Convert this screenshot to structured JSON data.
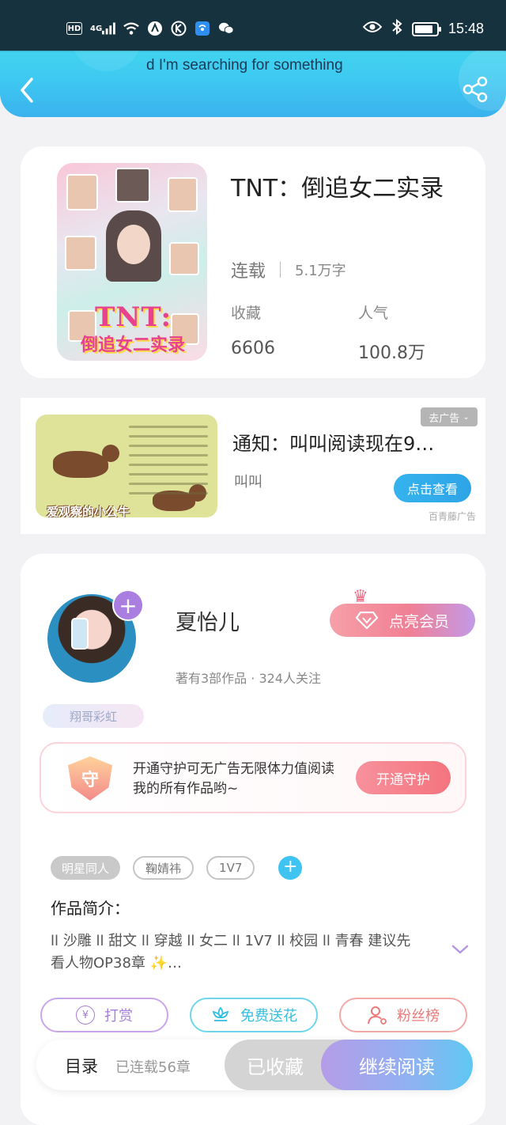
{
  "status_bar": {
    "time": "15:48",
    "network": "4G",
    "hd": "HD"
  },
  "header": {
    "marquee_text": "d I'm searching for something"
  },
  "book": {
    "title": "TNT：倒追女二实录",
    "status": "连载",
    "word_count": "5.1万字",
    "favorites_label": "收藏",
    "favorites_value": "6606",
    "popularity_label": "人气",
    "popularity_value": "100.8万",
    "cover_title": "TNT:",
    "cover_subtitle": "倒追女二实录"
  },
  "ad": {
    "remove_label": "去广告",
    "title": "通知：叫叫阅读现在9…",
    "source": "叫叫",
    "cta": "点击查看",
    "brand": "百青藤广告",
    "image_caption": "爱观察的小公牛"
  },
  "author": {
    "name": "夏怡儿",
    "stats": "著有3部作品 · 324人关注",
    "vip_label": "点亮会员",
    "badge": "翔哥彩虹",
    "guard_text": "开通守护可无广告无限体力值阅读我的所有作品哟~",
    "guard_icon_char": "守",
    "guard_button": "开通守护"
  },
  "tags": [
    "明星同人",
    "鞠婧祎",
    "1V7"
  ],
  "intro": {
    "title": "作品简介：",
    "text": "ll 沙雕 ll 甜文 ll 穿越 ll 女二 ll 1V7 ll 校园 ll 青春 建议先看人物OP38章 ✨…"
  },
  "actions": {
    "reward": "打赏",
    "flower": "免费送花",
    "fans": "粉丝榜"
  },
  "bottom": {
    "toc": "目录",
    "toc_count": "已连载56章",
    "saved": "已收藏",
    "continue": "继续阅读"
  },
  "colors": {
    "header_accent": "#3ec9f1",
    "purple_accent": "#a97ee0",
    "ad_button": "#35b3ee"
  }
}
